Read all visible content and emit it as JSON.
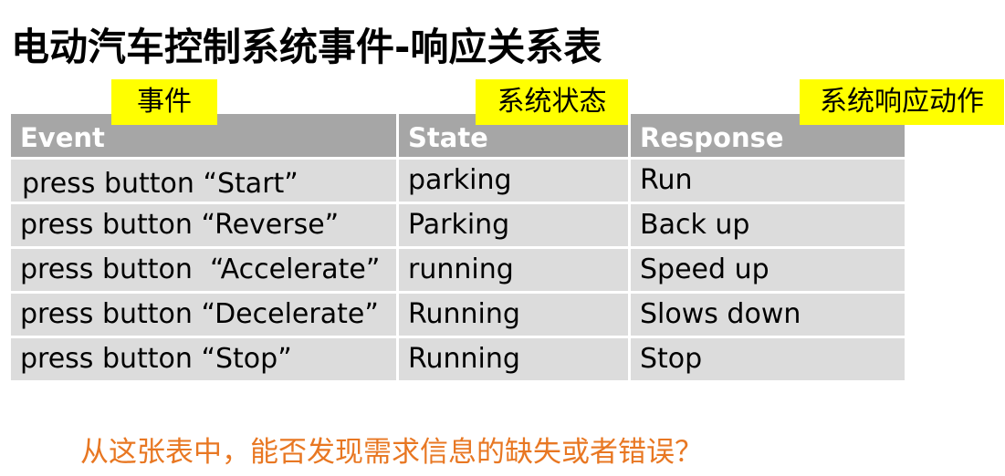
{
  "title": "电动汽车控制系统事件-响应关系表",
  "tags": {
    "event": "事件",
    "state": "系统状态",
    "response": "系统响应动作"
  },
  "table": {
    "headers": [
      "Event",
      "State",
      "Response"
    ],
    "rows": [
      [
        "press button “Start”",
        "parking",
        "Run"
      ],
      [
        "press button “Reverse”",
        "Parking",
        "Back up"
      ],
      [
        "press button  “Accelerate”",
        "running",
        "Speed up"
      ],
      [
        "press button “Decelerate”",
        "Running",
        "Slows down"
      ],
      [
        "press button “Stop”",
        "Running",
        "Stop"
      ]
    ]
  },
  "question": "从这张表中，能否发现需求信息的缺失或者错误？",
  "colors": {
    "header_bg": "#a6a6a6",
    "row_bg": "#dcdcdc",
    "tag_bg": "#ffff00",
    "question_text": "#e87722"
  }
}
